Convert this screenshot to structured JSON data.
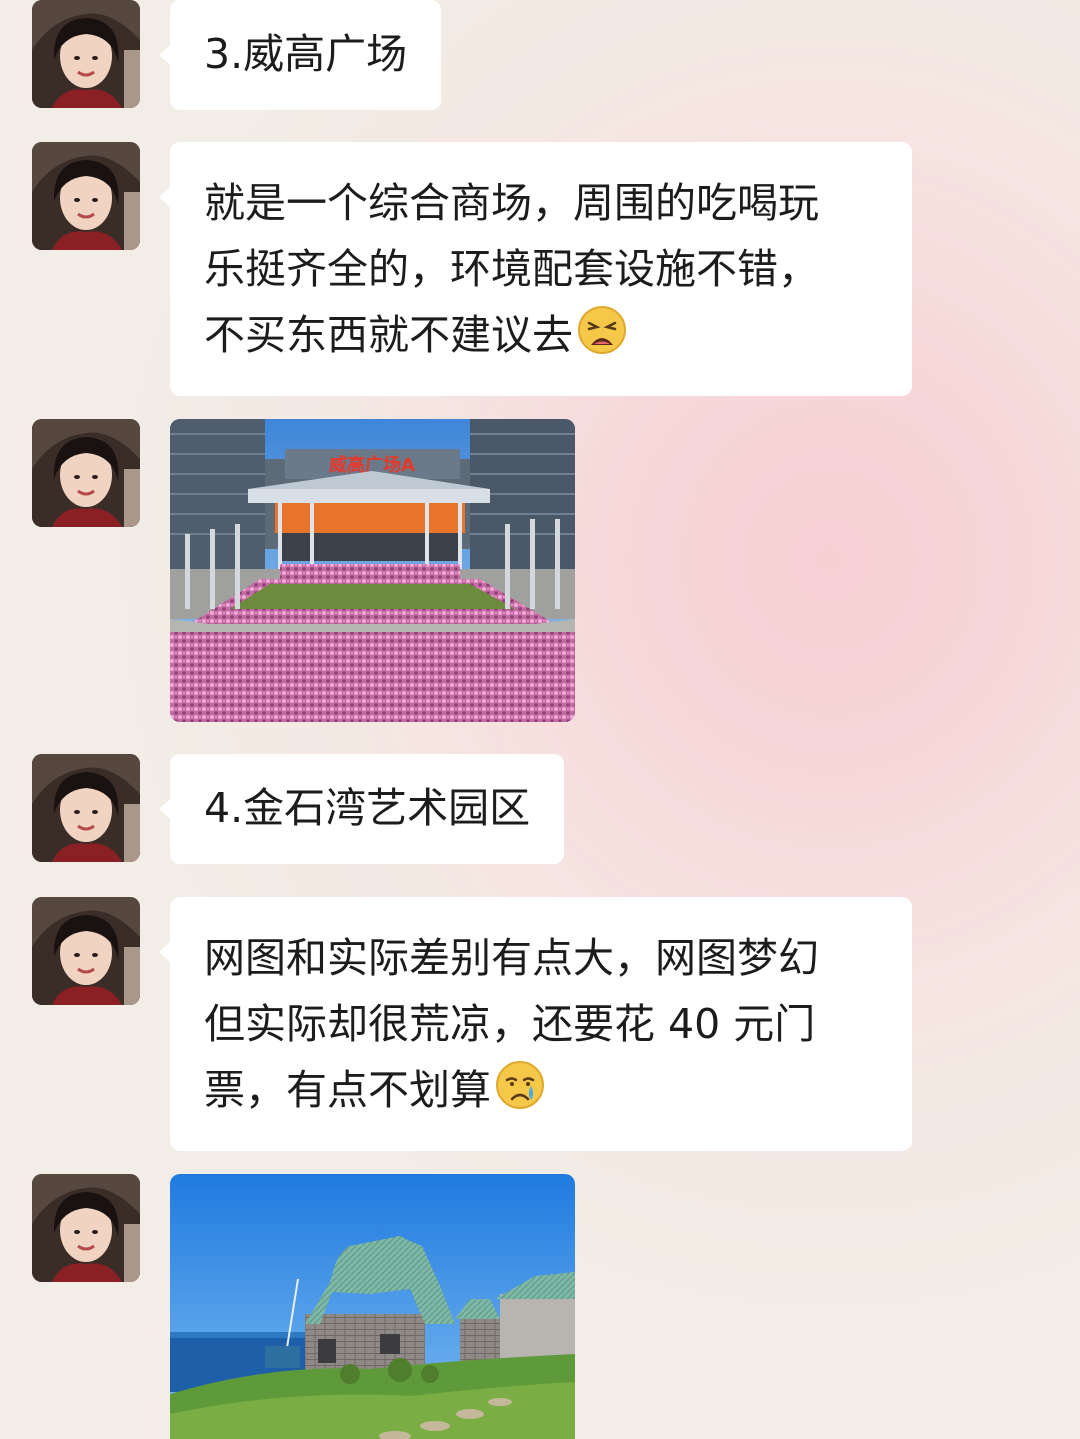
{
  "messages": [
    {
      "type": "text",
      "text": "3.威高广场"
    },
    {
      "type": "text",
      "lines": [
        "就是一个综合商场，周围的吃喝玩",
        "乐挺齐全的，环境配套设施不错，",
        "不买东西就不建议去"
      ],
      "emoji": "weary-face-emoji"
    },
    {
      "type": "image",
      "subject": "shopping-plaza-photo",
      "sign_text": "威高广场A"
    },
    {
      "type": "text",
      "text": "4.金石湾艺术园区"
    },
    {
      "type": "text",
      "lines": [
        "网图和实际差别有点大，网图梦幻",
        "但实际却很荒凉，还要花 40 元门",
        "票，有点不划算"
      ],
      "emoji": "crying-face-emoji"
    },
    {
      "type": "image",
      "subject": "thatched-cottage-by-sea-photo"
    }
  ],
  "colors": {
    "bubble": "#ffffff",
    "text": "#1c1c1c",
    "background_tint": "#f6d2d5"
  }
}
